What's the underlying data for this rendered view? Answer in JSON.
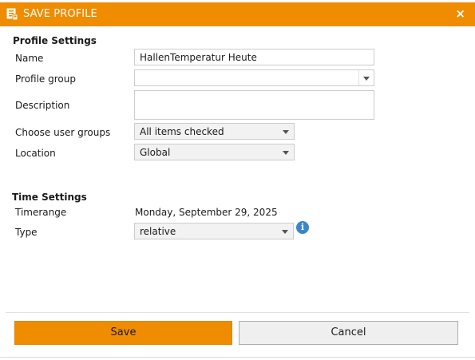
{
  "dialog": {
    "title": "SAVE PROFILE",
    "close_glyph": "×",
    "title_icon": "profile-save-icon",
    "accent_color": "#ef8c00"
  },
  "profile_settings": {
    "heading": "Profile Settings",
    "name_label": "Name",
    "name_value": "HallenTemperatur Heute",
    "profile_group_label": "Profile group",
    "profile_group_value": "",
    "description_label": "Description",
    "description_value": "",
    "user_groups_label": "Choose user groups",
    "user_groups_value": "All items checked",
    "location_label": "Location",
    "location_value": "Global"
  },
  "time_settings": {
    "heading": "Time Settings",
    "timerange_label": "Timerange",
    "timerange_value": "Monday, September 29, 2025",
    "type_label": "Type",
    "type_value": "relative",
    "info_glyph": "i"
  },
  "buttons": {
    "save_label": "Save",
    "cancel_label": "Cancel"
  }
}
